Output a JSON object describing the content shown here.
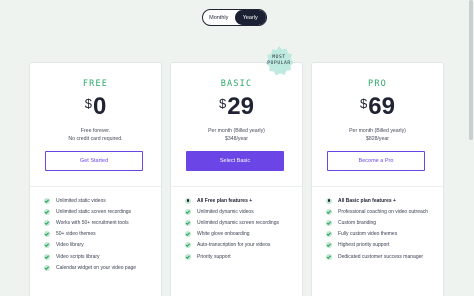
{
  "billing_toggle": {
    "monthly": "Monthly",
    "yearly": "Yearly",
    "selected": "Yearly"
  },
  "plans": [
    {
      "name": "FREE",
      "currency": "$",
      "price": "0",
      "line1": "Free forever.",
      "line2": "No credit card required.",
      "cta": "Get Started",
      "features": [
        "Unlimited static videos",
        "Unlimited static screen recordings",
        "Works with 50+ recruitment tools",
        "50+ video themes",
        "Video library",
        "Video scripts library",
        "Calendar widget on your video page"
      ]
    },
    {
      "name": "BASIC",
      "currency": "$",
      "price": "29",
      "line1": "Per month (Billed yearly)",
      "line2": "$348/year",
      "cta": "Select Basic",
      "badge": "MOST POPULAR",
      "features": [
        "All Free plan features +",
        "Unlimited dynamic videos",
        "Unlimited dynamic screen recordings",
        "White glove onboarding",
        "Auto-transcription for your videos",
        "Priority support"
      ]
    },
    {
      "name": "PRO",
      "currency": "$",
      "price": "69",
      "line1": "Per month (Billed yearly)",
      "line2": "$828/year",
      "cta": "Become a Pro",
      "features": [
        "All Basic plan features +",
        "Professional coaching on video outreach",
        "Custom branding",
        "Fully custom video themes",
        "Highest priority support",
        "Dedicated customer success manager"
      ]
    }
  ],
  "colors": {
    "background": "#eef3f0",
    "accent": "#6b45e6",
    "plan_name": "#2aa869",
    "check": "#bfe7cf",
    "dark": "#1c2033",
    "badge": "#bfeadf"
  },
  "icons": [
    "check-icon",
    "bullet-dot-icon",
    "popular-badge-icon"
  ]
}
